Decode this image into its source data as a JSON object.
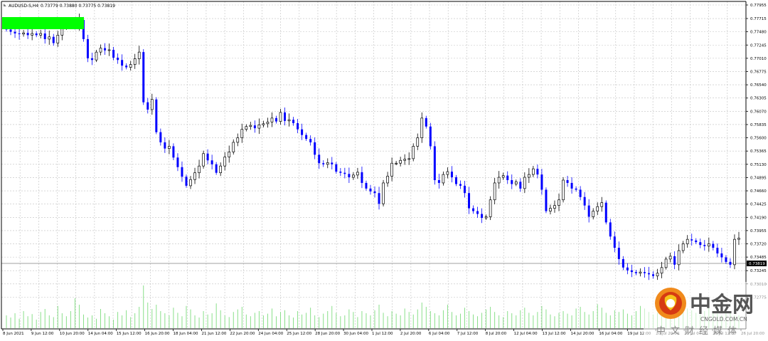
{
  "header": {
    "symbol": "AUDUSD-S,H4",
    "ohlc": "0.73779 0.73880 0.73775 0.73819"
  },
  "chart_data": {
    "type": "candlestick",
    "title": "AUDUSD-S,H4",
    "grid": true,
    "ylim": [
      0.72275,
      0.77955
    ],
    "y_ticks": [
      "0.77955",
      "0.77715",
      "0.77480",
      "0.77245",
      "0.77010",
      "0.76775",
      "0.76540",
      "0.76305",
      "0.76070",
      "0.75835",
      "0.75600",
      "0.75365",
      "0.75130",
      "0.74895",
      "0.74660",
      "0.74425",
      "0.74190",
      "0.73955",
      "0.73720",
      "0.73485",
      "0.73245",
      "0.73010",
      "0.72775"
    ],
    "current_price": "0.73819",
    "x_ticks": [
      "8 Jun 2021",
      "9 Jun 12:00",
      "10 Jun 20:00",
      "14 Jun 04:00",
      "15 Jun 12:00",
      "16 Jun 20:00",
      "18 Jun 04:00",
      "21 Jun 12:00",
      "22 Jun 20:00",
      "24 Jun 04:00",
      "25 Jun 12:00",
      "28 Jun 20:00",
      "30 Jun 04:00",
      "1 Jul 12:00",
      "2 Jul 20:00",
      "6 Jul 04:00",
      "7 Jul 12:00",
      "8 Jul 20:00",
      "12 Jul 04:00",
      "13 Jul 12:00",
      "14 Jul 20:00",
      "16 Jul 04:00",
      "19 Jul 12:00",
      "20 Jul 20:00",
      "22 Jul 04:00",
      "23 Jul 12:00",
      "26 Jul 20:00"
    ],
    "colors": {
      "bull_candle": "#000000",
      "bear_candle": "#0000ff",
      "volume": "#7ddc7d",
      "grid": "#c0c0c0",
      "highlight": "#00ff00",
      "price_line": "#808080"
    },
    "series": [
      {
        "name": "",
        "close": [
          0.7752,
          0.7748,
          0.7745,
          0.7744,
          0.7746,
          0.7742,
          0.7745,
          0.7742,
          0.7745,
          0.7735,
          0.7739,
          0.7728,
          0.7742,
          0.7755,
          0.776,
          0.7765,
          0.776,
          0.7769,
          0.7735,
          0.7701,
          0.7698,
          0.7712,
          0.7719,
          0.7715,
          0.7716,
          0.7702,
          0.7698,
          0.7688,
          0.7685,
          0.769,
          0.77,
          0.7712,
          0.7623,
          0.761,
          0.7628,
          0.757,
          0.7552,
          0.7541,
          0.7545,
          0.7525,
          0.7508,
          0.7491,
          0.7475,
          0.7486,
          0.7498,
          0.751,
          0.7532,
          0.752,
          0.7513,
          0.7498,
          0.751,
          0.7526,
          0.7535,
          0.7552,
          0.756,
          0.7575,
          0.758,
          0.7582,
          0.7577,
          0.7583,
          0.7585,
          0.7588,
          0.7595,
          0.7589,
          0.7605,
          0.759,
          0.7592,
          0.7586,
          0.7575,
          0.7565,
          0.7558,
          0.7552,
          0.753,
          0.7515,
          0.7513,
          0.7516,
          0.7513,
          0.75,
          0.7498,
          0.7496,
          0.749,
          0.7494,
          0.7499,
          0.748,
          0.747,
          0.7465,
          0.7462,
          0.7443,
          0.748,
          0.7492,
          0.7515,
          0.7515,
          0.752,
          0.7522,
          0.7523,
          0.7545,
          0.756,
          0.7595,
          0.758,
          0.7545,
          0.7485,
          0.748,
          0.7495,
          0.75,
          0.749,
          0.7478,
          0.7475,
          0.7462,
          0.7435,
          0.743,
          0.7425,
          0.7418,
          0.742,
          0.745,
          0.748,
          0.749,
          0.7493,
          0.7485,
          0.7478,
          0.7482,
          0.747,
          0.749,
          0.7495,
          0.7505,
          0.7495,
          0.7468,
          0.743,
          0.7435,
          0.744,
          0.745,
          0.7485,
          0.748,
          0.747,
          0.7468,
          0.7455,
          0.744,
          0.742,
          0.743,
          0.7438,
          0.7445,
          0.741,
          0.7385,
          0.7365,
          0.7345,
          0.733,
          0.7325,
          0.7322,
          0.732,
          0.7322,
          0.732,
          0.7318,
          0.7315,
          0.732,
          0.733,
          0.7345,
          0.735,
          0.7335,
          0.736,
          0.7372,
          0.738,
          0.7378,
          0.7375,
          0.737,
          0.7368,
          0.7372,
          0.7365,
          0.7355,
          0.7348,
          0.734,
          0.7335,
          0.738,
          0.7382
        ]
      },
      {
        "name": "",
        "volume": [
          0.3,
          0.25,
          0.35,
          0.22,
          0.4,
          0.28,
          0.33,
          0.2,
          0.38,
          0.45,
          0.3,
          0.26,
          0.52,
          0.35,
          0.28,
          0.4,
          0.7,
          0.55,
          0.32,
          0.25,
          0.3,
          0.22,
          0.45,
          0.35,
          0.28,
          0.2,
          0.38,
          0.3,
          0.42,
          0.26,
          0.35,
          0.5,
          1.0,
          0.6,
          0.45,
          0.55,
          0.4,
          0.35,
          0.3,
          0.48,
          0.36,
          0.28,
          0.52,
          0.44,
          0.3,
          0.25,
          0.4,
          0.32,
          0.35,
          0.58,
          0.42,
          0.3,
          0.26,
          0.38,
          0.44,
          0.5,
          0.32,
          0.28,
          0.36,
          0.4,
          0.3,
          0.34,
          0.46,
          0.28,
          0.38,
          0.42,
          0.3,
          0.25,
          0.4,
          0.32,
          0.36,
          0.48,
          0.3,
          0.26,
          0.34,
          0.4,
          0.52,
          0.36,
          0.28,
          0.3,
          0.44,
          0.38,
          0.26,
          0.4,
          0.35,
          0.3,
          0.42,
          0.55,
          0.36,
          0.28,
          0.4,
          0.34,
          0.3,
          0.46,
          0.38,
          0.32,
          0.44,
          0.6,
          0.5,
          0.4,
          0.35,
          0.3,
          0.42,
          0.55,
          0.38,
          0.3,
          0.34,
          0.48,
          0.4,
          0.32,
          0.28,
          0.36,
          0.44,
          0.5,
          0.38,
          0.3,
          0.26,
          0.4,
          0.35,
          0.3,
          0.42,
          0.48,
          0.36,
          0.3,
          0.38,
          0.52,
          0.44,
          0.32,
          0.28,
          0.36,
          0.4,
          0.34,
          0.3,
          0.46,
          0.5,
          0.38,
          0.32,
          0.4,
          0.56,
          0.48,
          0.36,
          0.3,
          0.42,
          0.38,
          0.44,
          0.34,
          0.3,
          0.4,
          0.52,
          0.46,
          0.38,
          0.32,
          0.36,
          0.44,
          0.5,
          0.4,
          0.34,
          0.3,
          0.38,
          0.46,
          0.42,
          0.36,
          0.32,
          0.4,
          0.48,
          0.38,
          0.34,
          0.3,
          0.42,
          0.36,
          0.3
        ]
      }
    ]
  }
}
